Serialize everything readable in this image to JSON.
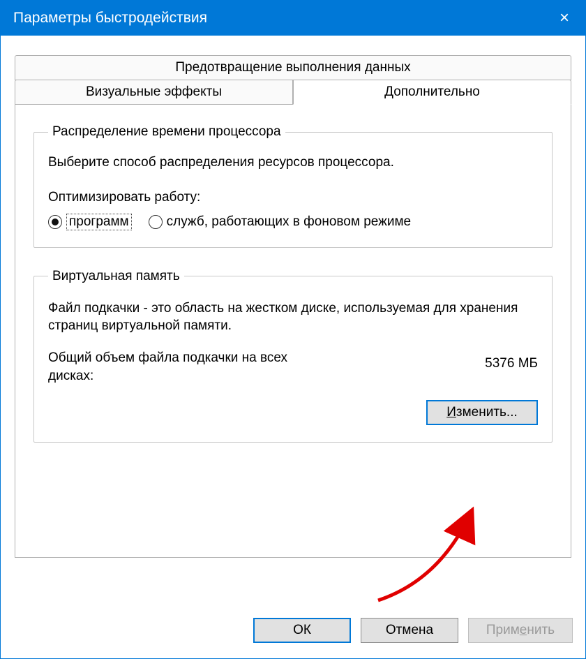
{
  "window": {
    "title": "Параметры быстродействия",
    "close_icon": "×"
  },
  "tabs": {
    "dep": "Предотвращение выполнения данных",
    "visual": "Визуальные эффекты",
    "advanced": "Дополнительно"
  },
  "cpu": {
    "legend": "Распределение времени процессора",
    "desc": "Выберите способ распределения ресурсов процессора.",
    "optimize_label": "Оптимизировать работу:",
    "radio_programs": "программ",
    "radio_services": "служб, работающих в фоновом режиме"
  },
  "vm": {
    "legend": "Виртуальная память",
    "desc": "Файл подкачки - это область на жестком диске, используемая для хранения страниц виртуальной памяти.",
    "total_label": "Общий объем файла подкачки на всех дисках:",
    "total_value": "5376 МБ",
    "change_prefix": "И",
    "change_rest": "зменить..."
  },
  "buttons": {
    "ok": "ОК",
    "cancel": "Отмена",
    "apply_prefix": "Прим",
    "apply_access": "е",
    "apply_rest": "нить"
  }
}
